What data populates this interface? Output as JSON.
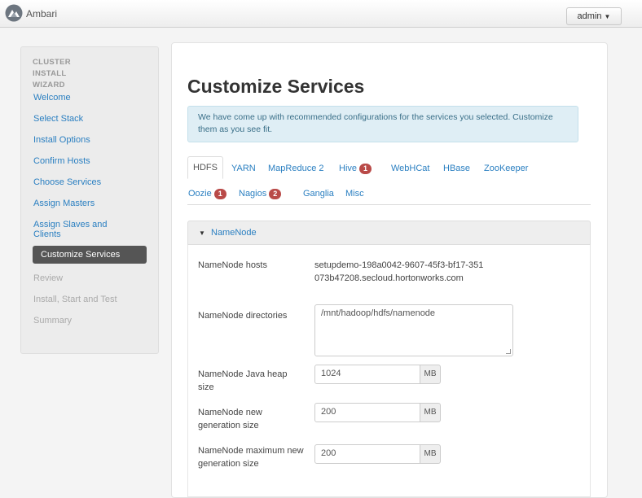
{
  "app": {
    "title": "Ambari",
    "user": "admin"
  },
  "sidebar": {
    "header": "CLUSTER INSTALL WIZARD",
    "items": [
      {
        "label": "Welcome",
        "state": "link"
      },
      {
        "label": "Select Stack",
        "state": "link"
      },
      {
        "label": "Install Options",
        "state": "link"
      },
      {
        "label": "Confirm Hosts",
        "state": "link"
      },
      {
        "label": "Choose Services",
        "state": "link"
      },
      {
        "label": "Assign Masters",
        "state": "link"
      },
      {
        "label": "Assign Slaves and Clients",
        "state": "link"
      },
      {
        "label": "Customize Services",
        "state": "active"
      },
      {
        "label": "Review",
        "state": "disabled"
      },
      {
        "label": "Install, Start and Test",
        "state": "disabled"
      },
      {
        "label": "Summary",
        "state": "disabled"
      }
    ]
  },
  "main": {
    "title": "Customize Services",
    "alert": "We have come up with recommended configurations for the services you selected. Customize them as you see fit.",
    "tabs": [
      {
        "label": "HDFS",
        "badge": ""
      },
      {
        "label": "YARN",
        "badge": ""
      },
      {
        "label": "MapReduce 2",
        "badge": ""
      },
      {
        "label": "Hive",
        "badge": "1"
      },
      {
        "label": "WebHCat",
        "badge": ""
      },
      {
        "label": "HBase",
        "badge": ""
      },
      {
        "label": "ZooKeeper",
        "badge": ""
      },
      {
        "label": "Oozie",
        "badge": "1"
      },
      {
        "label": "Nagios",
        "badge": "2"
      },
      {
        "label": "Ganglia",
        "badge": ""
      },
      {
        "label": "Misc",
        "badge": ""
      }
    ],
    "section": {
      "title": "NameNode",
      "hosts_label": "NameNode hosts",
      "hosts_value": "setupdemo-198a0042-9607-45f3-bf17-351073b47208.secloud.hortonworks.com",
      "dirs_label": "NameNode directories",
      "dirs_value": "/mnt/hadoop/hdfs/namenode",
      "heap_label": "NameNode Java heap size",
      "heap_value": "1024",
      "newgen_label": "NameNode new generation size",
      "newgen_value": "200",
      "maxnewgen_label": "NameNode maximum new generation size",
      "maxnewgen_value": "200",
      "unit": "MB"
    }
  }
}
